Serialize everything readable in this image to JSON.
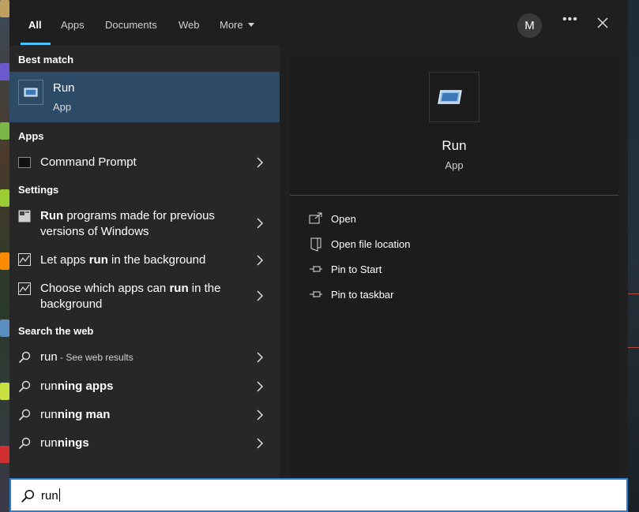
{
  "tabs": [
    {
      "label": "All"
    },
    {
      "label": "Apps"
    },
    {
      "label": "Documents"
    },
    {
      "label": "Web"
    },
    {
      "label": "More"
    }
  ],
  "avatar_initial": "M",
  "best_match": {
    "section": "Best match",
    "title": "Run",
    "subtitle": "App"
  },
  "apps_section": "Apps",
  "apps": [
    {
      "label": "Command Prompt"
    }
  ],
  "settings_section": "Settings",
  "settings": [
    {
      "bold": "Run",
      "rest": " programs made for previous versions of Windows"
    },
    {
      "pre": "Let apps ",
      "bold": "run",
      "post": " in the background"
    },
    {
      "pre": "Choose which apps can ",
      "bold": "run",
      "post": " in the background"
    }
  ],
  "web_section": "Search the web",
  "web": [
    {
      "label": "run",
      "hint": " - See web results"
    },
    {
      "pre": "run",
      "bold": "ning apps"
    },
    {
      "pre": "run",
      "bold": "ning man"
    },
    {
      "pre": "run",
      "bold": "nings"
    }
  ],
  "details": {
    "name": "Run",
    "type": "App",
    "actions": [
      {
        "label": "Open"
      },
      {
        "label": "Open file location"
      },
      {
        "label": "Pin to Start"
      },
      {
        "label": "Pin to taskbar"
      }
    ]
  },
  "search": {
    "value": "run"
  },
  "colors": {
    "accent": "#4cc2ff",
    "selection": "#2d4a66",
    "panel": "#272727",
    "border": "#2b7cd3"
  }
}
